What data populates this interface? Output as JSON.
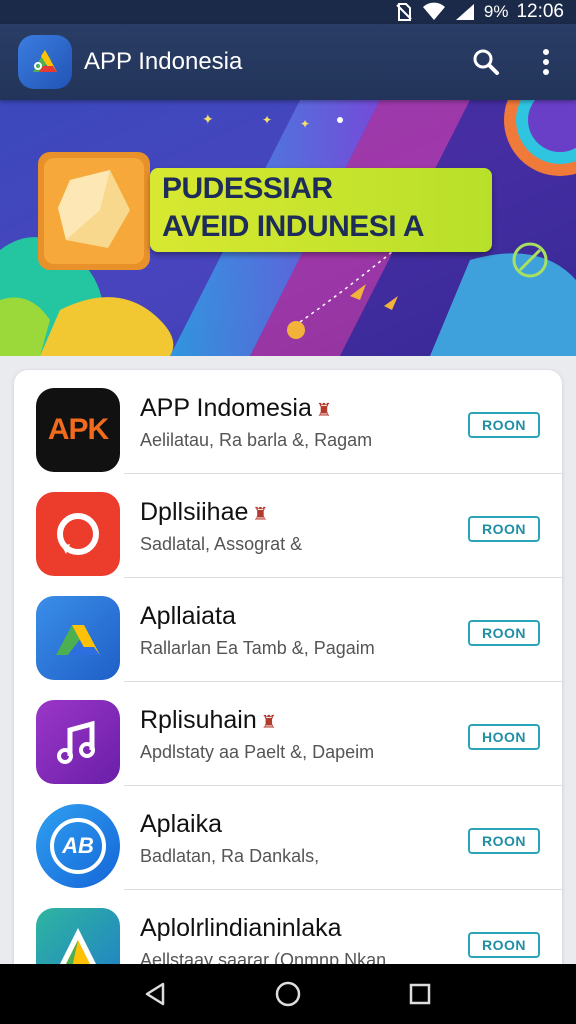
{
  "status_bar": {
    "battery": "9%",
    "time": "12:06",
    "icons": [
      "no-sim-icon",
      "wifi-icon",
      "battery-icon"
    ]
  },
  "app_bar": {
    "title": "APP Indonesia",
    "icons": [
      "app-logo-icon",
      "search-icon",
      "more-vert-icon"
    ]
  },
  "banner": {
    "line1": "PUDESSIAR",
    "line2": "AVEID INDUNESI A"
  },
  "apps": [
    {
      "title": "APP Indomesia",
      "subtitle": "Aelilatau, Ra barla &, Ragam",
      "button": "ROON",
      "icon": "apk-icon",
      "icon_text": "APK",
      "badge": true
    },
    {
      "title": "Dpllsiihae",
      "subtitle": "Sadlatal, Assograt &",
      "button": "ROON",
      "icon": "chat-bubble-icon",
      "icon_text": "",
      "badge": true
    },
    {
      "title": "Apllaiata",
      "subtitle": "Rallarlan Ea Tamb &, Pagaim",
      "button": "ROON",
      "icon": "drive-icon",
      "icon_text": "",
      "badge": false
    },
    {
      "title": "Rplisuhain",
      "subtitle": "Apdlstaty aa Paelt &, Dapeim",
      "button": "HOON",
      "icon": "music-note-icon",
      "icon_text": "",
      "badge": true
    },
    {
      "title": "Aplaika",
      "subtitle": "Badlatan, Ra Dankals,",
      "button": "ROON",
      "icon": "ab-circle-icon",
      "icon_text": "AB",
      "badge": false
    },
    {
      "title": "Aplolrlindianinlaka",
      "subtitle": "Aellstaay saarar (Onmnp Nkan",
      "button": "ROON",
      "icon": "triangle-logo-icon",
      "icon_text": "",
      "badge": false
    }
  ],
  "nav_bar": {
    "icons": [
      "back-icon",
      "home-icon",
      "recents-icon"
    ]
  },
  "colors": {
    "app_bar": "#223459",
    "button_border": "#2ba3b8",
    "banner_label": "#c8e42c"
  }
}
